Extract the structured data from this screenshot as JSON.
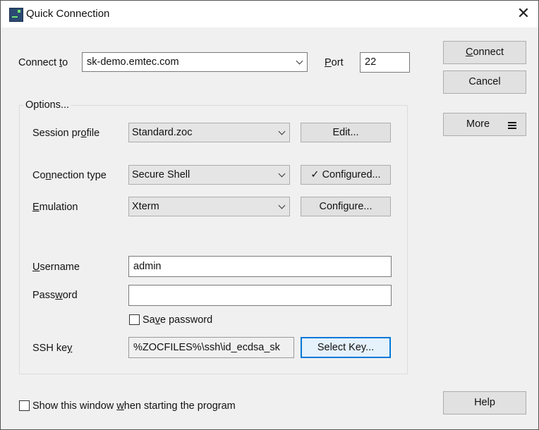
{
  "window": {
    "title": "Quick Connection",
    "close_glyph": "✕"
  },
  "connection": {
    "connect_to_label_pre": "Connect ",
    "connect_to_label_key": "t",
    "connect_to_label_post": "o",
    "host_value": "sk-demo.emtec.com",
    "port_label_key": "P",
    "port_label_post": "ort",
    "port_value": "22"
  },
  "actions": {
    "connect_label_key": "C",
    "connect_label_post": "onnect",
    "cancel_label": "Cancel",
    "more_label": "More",
    "help_label": "Help"
  },
  "options": {
    "group_title": "Options...",
    "session_profile": {
      "label_pre": "Session pr",
      "label_key": "o",
      "label_post": "file",
      "value": "Standard.zoc",
      "button": "Edit..."
    },
    "connection_type": {
      "label_pre": "Co",
      "label_key": "n",
      "label_post": "nection type",
      "value": "Secure Shell",
      "button": "✓ Configured..."
    },
    "emulation": {
      "label_key": "E",
      "label_post": "mulation",
      "value": "Xterm",
      "button": "Configure..."
    },
    "username": {
      "label_key": "U",
      "label_post": "sername",
      "value": "admin"
    },
    "password": {
      "label_pre": "Pass",
      "label_key": "w",
      "label_post": "ord",
      "value": ""
    },
    "save_password": {
      "label_pre": "Sa",
      "label_key": "v",
      "label_post": "e password",
      "checked": false
    },
    "ssh_key": {
      "label_pre": "SSH ke",
      "label_key": "y",
      "value": "%ZOCFILES%\\ssh\\id_ecdsa_sk",
      "button": "Select Key..."
    }
  },
  "footer": {
    "show_window_pre": "Show this window ",
    "show_window_key": "w",
    "show_window_post": "hen starting the program",
    "show_window_checked": false
  },
  "icons": {
    "app": "zoc-terminal-icon",
    "close": "close-icon",
    "dropdown": "chevron-down-icon",
    "menu": "hamburger-menu-icon",
    "check": "checkmark-icon"
  },
  "colors": {
    "window_bg": "#f0f0f0",
    "titlebar_bg": "#ffffff",
    "button_bg": "#e1e1e1",
    "focus_border": "#0078d7"
  }
}
